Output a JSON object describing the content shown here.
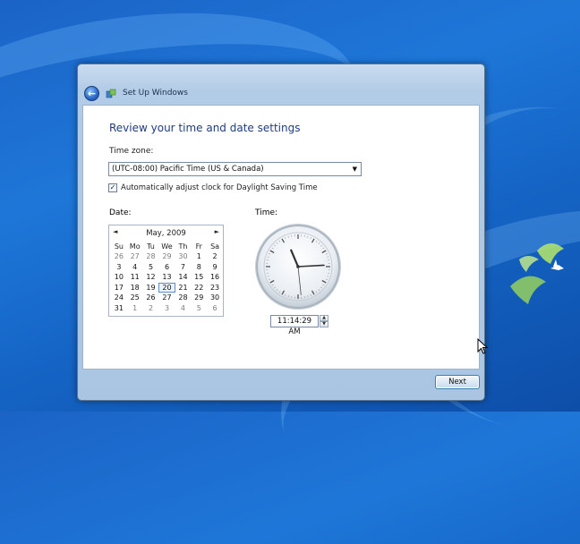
{
  "window": {
    "title": "Set Up Windows",
    "heading": "Review your time and date settings",
    "back_label": "←"
  },
  "timezone": {
    "label": "Time zone:",
    "value": "(UTC-08:00) Pacific Time (US & Canada)",
    "arrow": "▼"
  },
  "dst": {
    "checked": true,
    "check_mark": "✓",
    "label": "Automatically adjust clock for Daylight Saving Time"
  },
  "date": {
    "label": "Date:",
    "calendar": {
      "title": "May, 2009",
      "prev": "◄",
      "next": "►",
      "weekdays": [
        "Su",
        "Mo",
        "Tu",
        "We",
        "Th",
        "Fr",
        "Sa"
      ],
      "weeks": [
        [
          "26",
          "27",
          "28",
          "29",
          "30",
          "1",
          "2"
        ],
        [
          "3",
          "4",
          "5",
          "6",
          "7",
          "8",
          "9"
        ],
        [
          "10",
          "11",
          "12",
          "13",
          "14",
          "15",
          "16"
        ],
        [
          "17",
          "18",
          "19",
          "20",
          "21",
          "22",
          "23"
        ],
        [
          "24",
          "25",
          "26",
          "27",
          "28",
          "29",
          "30"
        ],
        [
          "31",
          "1",
          "2",
          "3",
          "4",
          "5",
          "6"
        ]
      ],
      "selected": "20"
    }
  },
  "time": {
    "label": "Time:",
    "value": "11:14:29 AM",
    "hour": 11,
    "minute": 14,
    "second": 29,
    "spin_up": "▲",
    "spin_down": "▼"
  },
  "footer": {
    "next_label": "Next"
  }
}
